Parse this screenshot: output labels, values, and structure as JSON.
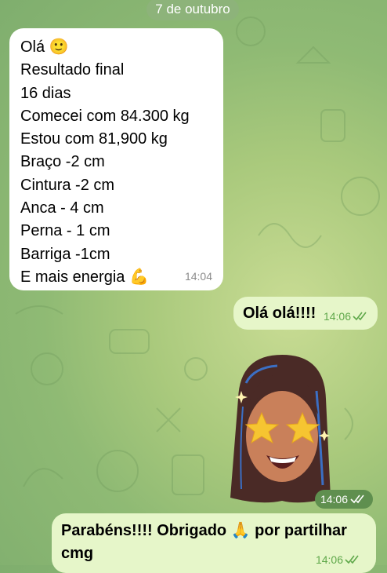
{
  "chat": {
    "date_label": "7 de outubro",
    "messages": [
      {
        "direction": "incoming",
        "lines": [
          "Olá 🙂",
          "Resultado final",
          "16 dias",
          "Comecei com 84.300 kg",
          "Estou com 81,900 kg",
          "Braço -2 cm",
          "Cintura -2 cm",
          "Anca - 4 cm",
          "Perna - 1 cm",
          "Barriga -1cm",
          "E mais energia 💪"
        ],
        "time": "14:04"
      },
      {
        "direction": "outgoing",
        "text": "Olá olá!!!!",
        "time": "14:06",
        "status": "read"
      },
      {
        "direction": "outgoing",
        "type": "sticker",
        "sticker": "memoji-star-eyes",
        "time": "14:06",
        "status": "read"
      },
      {
        "direction": "outgoing",
        "text": "Parabéns!!!! Obrigado 🙏 por partilhar cmg",
        "time": "14:06",
        "status": "read"
      }
    ]
  },
  "colors": {
    "incoming_bubble": "#ffffff",
    "outgoing_bubble": "#e6f6c9",
    "outgoing_time": "#5fa84a",
    "background": "#a9c97c"
  }
}
